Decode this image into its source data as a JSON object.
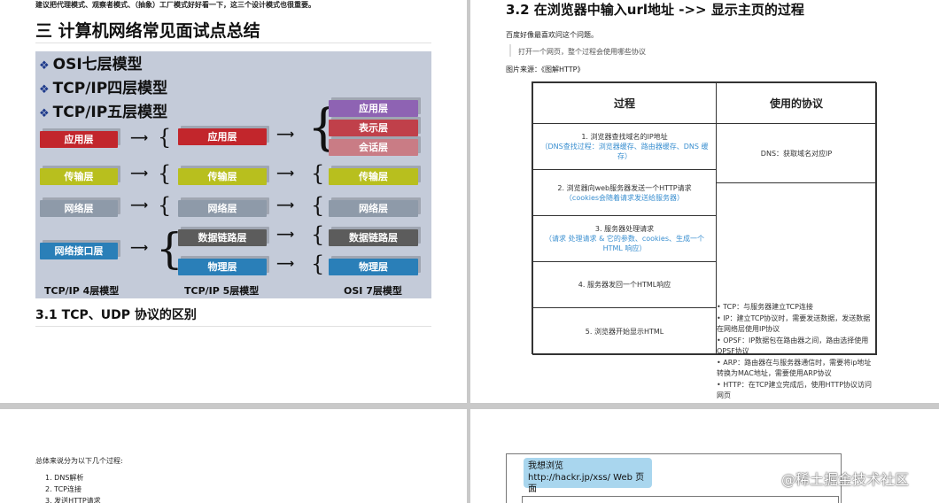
{
  "page1": {
    "intro": "建议把代理模式、观察者模式、（抽象）工厂模式好好看一下，这三个设计模式也很重要。",
    "section_title": "三 计算机网络常见面试点总结",
    "diagram": {
      "bullets": [
        "OSI七层模型",
        "TCP/IP四层模型",
        "TCP/IP五层模型"
      ],
      "tcp4": [
        "应用层",
        "传输层",
        "网络层",
        "网络接口层"
      ],
      "tcp5": [
        "应用层",
        "传输层",
        "网络层",
        "数据链路层",
        "物理层"
      ],
      "osi7": [
        "应用层",
        "表示层",
        "会话层",
        "传输层",
        "网络层",
        "数据链路层",
        "物理层"
      ],
      "captions": [
        "TCP/IP 4层模型",
        "TCP/IP 5层模型",
        "OSI 7层模型"
      ]
    },
    "subsection": "3.1 TCP、UDP 协议的区别"
  },
  "page2": {
    "title": "3.2 在浏览器中输入url地址 ->> 显示主页的过程",
    "line1": "百度好像最喜欢问这个问题。",
    "quote": "打开一个网页，整个过程会使用哪些协议",
    "source": "图片来源：《图解HTTP》",
    "table": {
      "headers": [
        "过程",
        "使用的协议"
      ],
      "steps": [
        {
          "text": "1. 浏览器查找域名的IP地址",
          "note": "（DNS查找过程：浏览器缓存、路由器缓存、DNS 缓存）"
        },
        {
          "text": "2. 浏览器向web服务器发送一个HTTP请求",
          "note": "（cookies会随着请求发送给服务器）"
        },
        {
          "text": "3. 服务器处理请求",
          "note": "（请求 处理请求 & 它的参数、cookies、生成一个HTML 响应）"
        },
        {
          "text": "4. 服务器发回一个HTML响应",
          "note": ""
        },
        {
          "text": "5. 浏览器开始显示HTML",
          "note": ""
        }
      ],
      "dns": "DNS：获取域名对应IP",
      "protocols": [
        "• TCP：与服务器建立TCP连接",
        "• IP：建立TCP协议时，需要发送数据，发送数据在网络层使用IP协议",
        "• OPSF：IP数据包在路由器之间，路由选择使用OPSF协议",
        "• ARP：路由器在与服务器通信时，需要将ip地址转换为MAC地址，需要使用ARP协议",
        "• HTTP：在TCP建立完成后，使用HTTP协议访问网页"
      ]
    }
  },
  "page3": {
    "intro": "总体来说分为以下几个过程:",
    "items": [
      "1. DNS解析",
      "2. TCP连接",
      "3. 发送HTTP请求"
    ]
  },
  "page4": {
    "bubble_line1": "我想浏览",
    "bubble_line2": "http://hackr.jp/xss/ Web 页面"
  },
  "watermark": "@稀土掘金技术社区"
}
